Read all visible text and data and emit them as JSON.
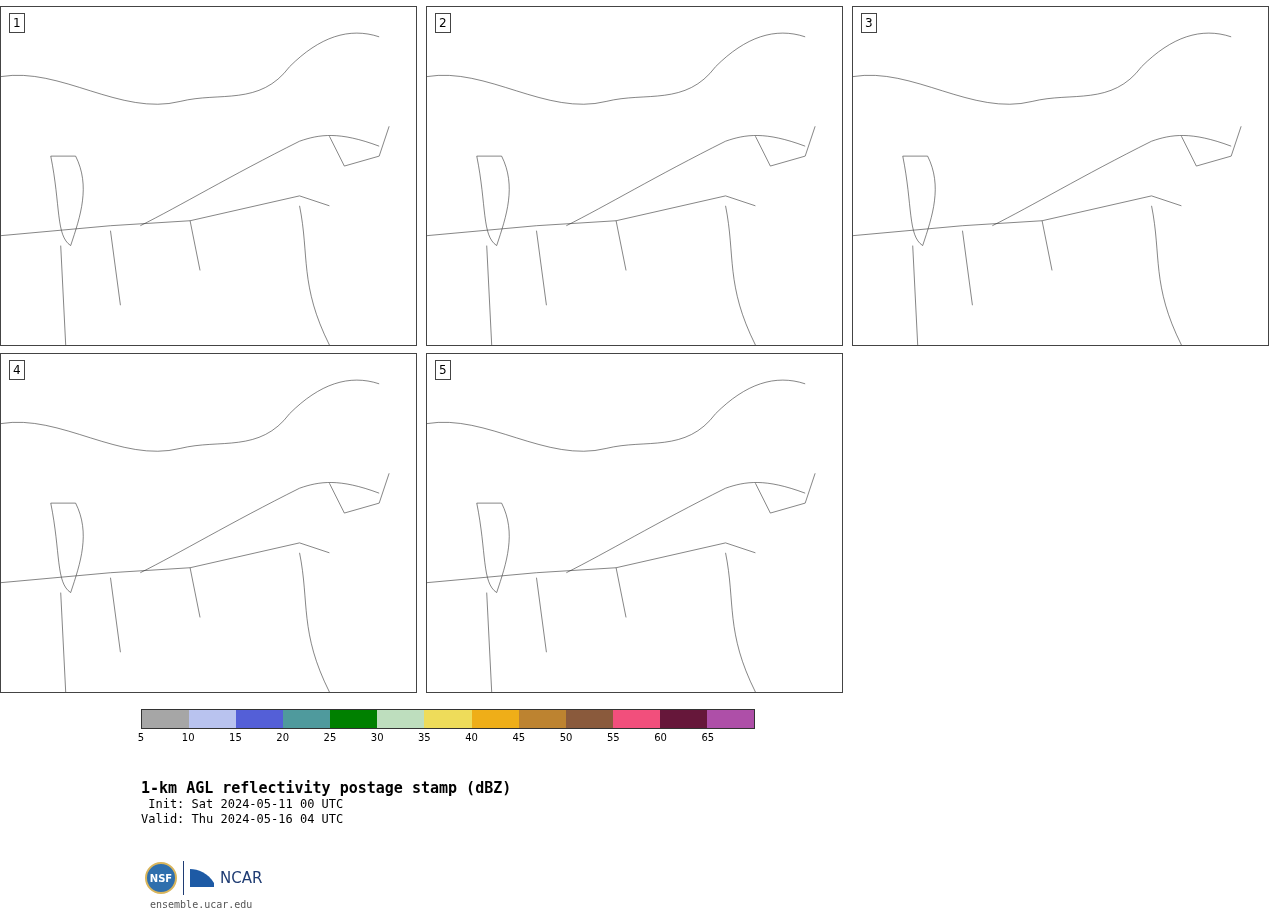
{
  "panels": [
    {
      "label": "1"
    },
    {
      "label": "2"
    },
    {
      "label": "3"
    },
    {
      "label": "4"
    },
    {
      "label": "5"
    }
  ],
  "colorbar": {
    "segments": [
      {
        "color": "#a6a6a6"
      },
      {
        "color": "#b9c3ef"
      },
      {
        "color": "#545fd7"
      },
      {
        "color": "#4f9a9d"
      },
      {
        "color": "#008000"
      },
      {
        "color": "#bedebe"
      },
      {
        "color": "#eedc5a"
      },
      {
        "color": "#efae18"
      },
      {
        "color": "#bd8330"
      },
      {
        "color": "#8a5a3c"
      },
      {
        "color": "#f24f7c"
      },
      {
        "color": "#66173a"
      },
      {
        "color": "#ae4fa8"
      }
    ],
    "ticks": [
      "5",
      "10",
      "15",
      "20",
      "25",
      "30",
      "35",
      "40",
      "45",
      "50",
      "55",
      "60",
      "65"
    ]
  },
  "title": "1-km AGL reflectivity postage stamp (dBZ)",
  "init": " Init: Sat 2024-05-11 00 UTC",
  "valid": "Valid: Thu 2024-05-16 04 UTC",
  "logo": {
    "left": "NSF",
    "right": "NCAR"
  },
  "url": "ensemble.ucar.edu"
}
